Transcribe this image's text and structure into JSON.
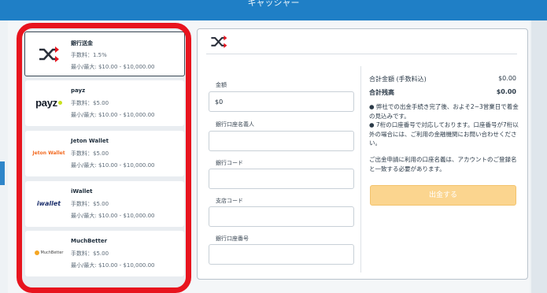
{
  "header": {
    "title": "キャッシャー"
  },
  "methods": [
    {
      "name": "銀行送金",
      "fee": "手数料：1.5%",
      "limit": "最小/最大: $10.00 - $10,000.00",
      "logo": "shuffle-icon"
    },
    {
      "name": "payz",
      "fee": "手数料：$5.00",
      "limit": "最小/最大: $10.00 - $10,000.00",
      "logo_text": "payz"
    },
    {
      "name": "Jeton Wallet",
      "fee": "手数料：$5.00",
      "limit": "最小/最大: $10.00 - $10,000.00",
      "logo_text": "Jeton Wallet"
    },
    {
      "name": "iWallet",
      "fee": "手数料：$5.00",
      "limit": "最小/最大: $10.00 - $10,000.00",
      "logo_text": "iwallet"
    },
    {
      "name": "MuchBetter",
      "fee": "手数料：$5.00",
      "limit": "最小/最大: $10.00 - $10,000.00",
      "logo_text": "MuchBetter"
    }
  ],
  "form": {
    "amount_label": "金額",
    "amount_value": "$0",
    "account_name_label": "銀行口座名義人",
    "bank_code_label": "銀行コード",
    "branch_code_label": "支店コード",
    "account_number_label": "銀行口座番号"
  },
  "summary": {
    "total_label": "合計金額 (手数料込)",
    "total_value": "$0.00",
    "balance_label": "合計残高",
    "balance_value": "$0.00",
    "note1": "● 弊社での出金手続き完了後、およそ2~3営業日で着金の見込みです。",
    "note2": "● 7桁の口座番号で対応しております。口座番号が7桁以外の場合には、ご利用の金融機関にお問い合わせください。",
    "note3": "ご出金申請に利用の口座名義は、アカウントのご登録名と一致する必要があります。",
    "withdraw_button": "出金する"
  },
  "colors": {
    "accent_red": "#e8141e",
    "button": "#fbd58f",
    "topbar": "#1f7fc6",
    "icon_dark": "#2a2f3a"
  }
}
